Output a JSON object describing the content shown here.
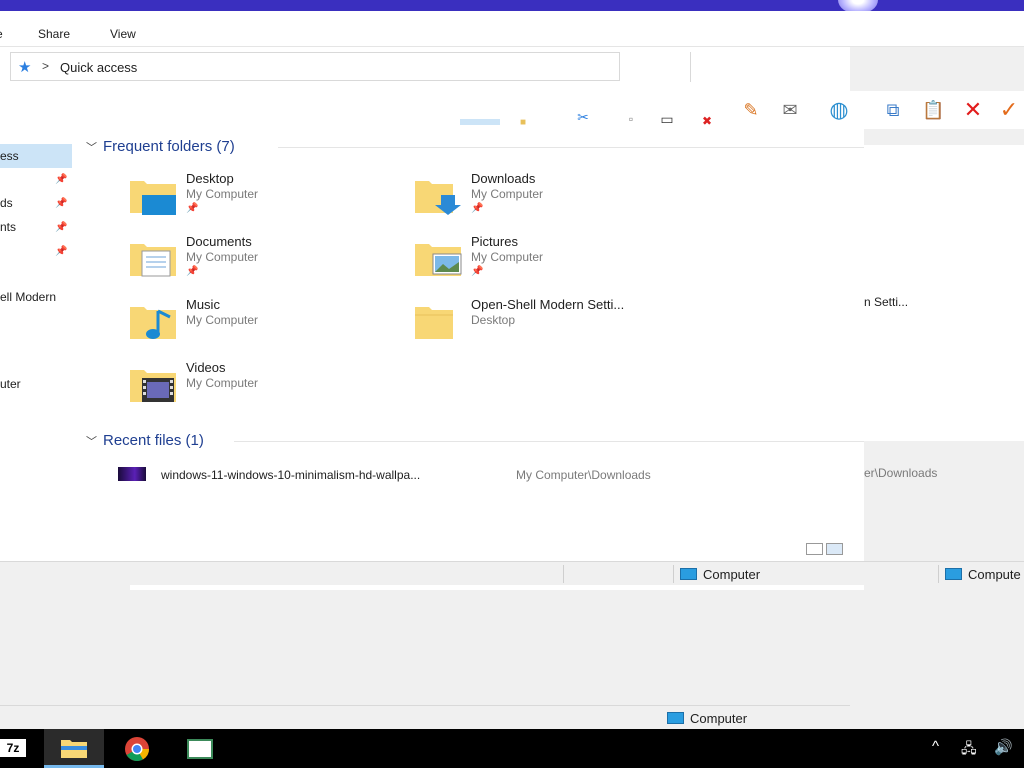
{
  "ribbon": {
    "tabs": [
      "e",
      "Share",
      "View"
    ]
  },
  "address": {
    "location": "Quick access",
    "separator": ">"
  },
  "nav": {
    "items": [
      "ess",
      "ds",
      "nts",
      "ell Modern",
      "uter"
    ]
  },
  "frequent": {
    "header": "Frequent folders (7)",
    "folders": [
      {
        "name": "Desktop",
        "sub": "My Computer",
        "icon": "desktop-folder-icon"
      },
      {
        "name": "Downloads",
        "sub": "My Computer",
        "icon": "downloads-folder-icon"
      },
      {
        "name": "Documents",
        "sub": "My Computer",
        "icon": "documents-folder-icon"
      },
      {
        "name": "Pictures",
        "sub": "My Computer",
        "icon": "pictures-folder-icon"
      },
      {
        "name": "Music",
        "sub": "My Computer",
        "icon": "music-folder-icon"
      },
      {
        "name": "Open-Shell Modern Setti...",
        "sub": "Desktop",
        "icon": "folder-icon"
      },
      {
        "name": "Videos",
        "sub": "My Computer",
        "icon": "videos-folder-icon"
      }
    ]
  },
  "recent": {
    "header": "Recent files (1)",
    "files": [
      {
        "name": "windows-11-windows-10-minimalism-hd-wallpa...",
        "path": "My Computer\\Downloads"
      }
    ]
  },
  "ghost": {
    "item": "n Setti...",
    "path": "er\\Downloads"
  },
  "status": {
    "computer_label": "Computer",
    "computer_label_2": "Compute"
  },
  "taskbar": {
    "seven_zip": "7z"
  },
  "colors": {
    "accent": "#1f3f91",
    "selection": "#cce4f7",
    "taskbar": "#000000"
  }
}
